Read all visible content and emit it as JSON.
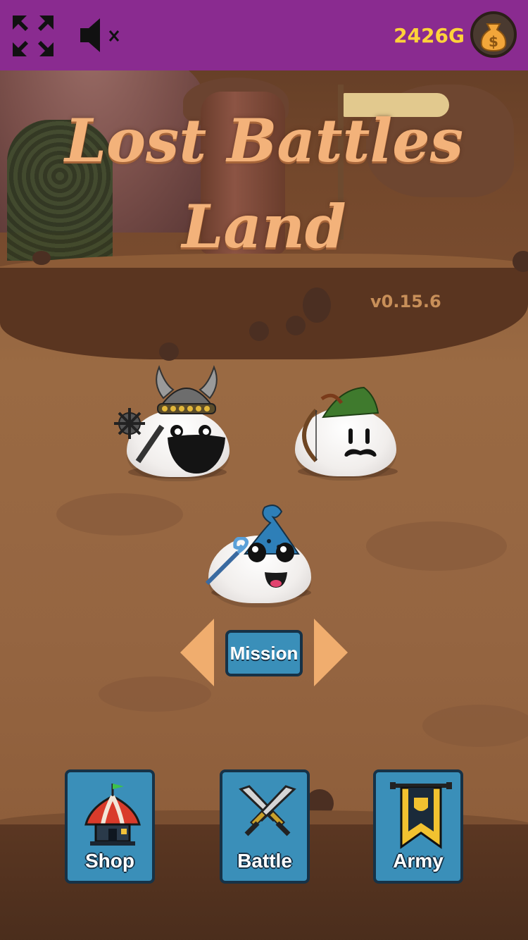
{
  "topbar": {
    "gold": "2426G",
    "icons": [
      "fullscreen-icon",
      "mute-icon",
      "money-bag-icon"
    ],
    "background_color": "#8a2b90",
    "gold_color": "#ffd23a"
  },
  "title": {
    "line1": "Lost Battles",
    "line2": "Land",
    "version": "v0.15.6",
    "color": "#f3b27a"
  },
  "characters": [
    {
      "name": "viking",
      "icons": [
        "horned-helmet-icon",
        "mace-icon"
      ]
    },
    {
      "name": "archer",
      "icons": [
        "feather-hat-icon",
        "bow-icon"
      ]
    },
    {
      "name": "wizard",
      "icons": [
        "wizard-hat-icon",
        "staff-icon"
      ]
    }
  ],
  "mission": {
    "label": "Mission",
    "prev_icon": "arrow-left-icon",
    "next_icon": "arrow-right-icon"
  },
  "menu": {
    "shop": "Shop",
    "battle": "Battle",
    "army": "Army",
    "button_color": "#3a8fb9"
  }
}
